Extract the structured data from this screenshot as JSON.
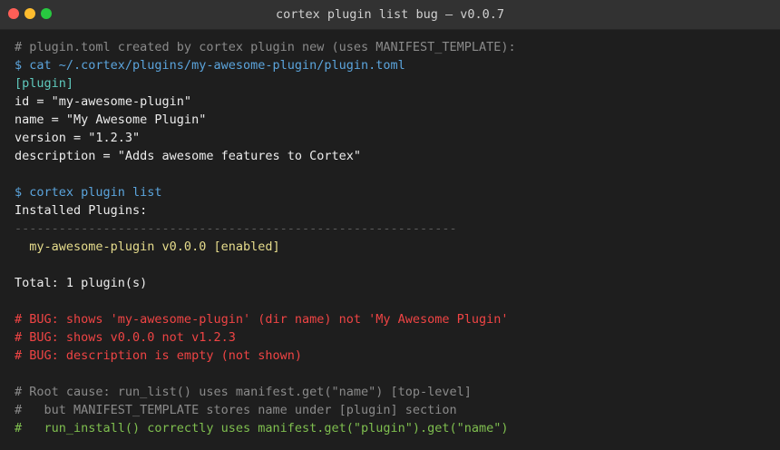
{
  "window": {
    "title": "cortex plugin list bug — v0.0.7"
  },
  "colors": {
    "background": "#1e1e1e",
    "titlebar": "#323232",
    "comment": "#8a8a8a",
    "prompt": "#5ba4dc",
    "section": "#5fc9bd",
    "text": "#ececec",
    "rule": "#5a5a5a",
    "plugin_entry": "#e6dc8c",
    "bug": "#ef4444",
    "fix_hint": "#7fbf4f"
  },
  "terminal": {
    "lines": [
      {
        "text": "# plugin.toml created by cortex plugin new (uses MANIFEST_TEMPLATE):",
        "style": "comment"
      },
      {
        "text": "$ cat ~/.cortex/plugins/my-awesome-plugin/plugin.toml",
        "style": "prompt"
      },
      {
        "text": "[plugin]",
        "style": "section"
      },
      {
        "text": "id = \"my-awesome-plugin\"",
        "style": "normal"
      },
      {
        "text": "name = \"My Awesome Plugin\"",
        "style": "normal"
      },
      {
        "text": "version = \"1.2.3\"",
        "style": "normal"
      },
      {
        "text": "description = \"Adds awesome features to Cortex\"",
        "style": "normal"
      },
      {
        "text": "",
        "style": "normal"
      },
      {
        "text": "$ cortex plugin list",
        "style": "prompt"
      },
      {
        "text": "Installed Plugins:",
        "style": "normal"
      },
      {
        "text": "------------------------------------------------------------",
        "style": "rule"
      },
      {
        "text": "  my-awesome-plugin v0.0.0 [enabled]",
        "style": "plugin"
      },
      {
        "text": "",
        "style": "normal"
      },
      {
        "text": "Total: 1 plugin(s)",
        "style": "normal"
      },
      {
        "text": "",
        "style": "normal"
      },
      {
        "text": "# BUG: shows 'my-awesome-plugin' (dir name) not 'My Awesome Plugin'",
        "style": "bug"
      },
      {
        "text": "# BUG: shows v0.0.0 not v1.2.3",
        "style": "bug"
      },
      {
        "text": "# BUG: description is empty (not shown)",
        "style": "bug"
      },
      {
        "text": "",
        "style": "normal"
      },
      {
        "text": "# Root cause: run_list() uses manifest.get(\"name\") [top-level]",
        "style": "comment"
      },
      {
        "text": "#   but MANIFEST_TEMPLATE stores name under [plugin] section",
        "style": "comment"
      },
      {
        "text": "#   run_install() correctly uses manifest.get(\"plugin\").get(\"name\")",
        "style": "green"
      }
    ]
  }
}
